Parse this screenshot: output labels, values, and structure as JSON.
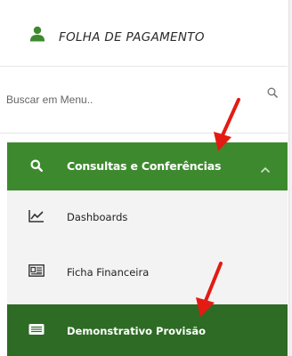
{
  "header": {
    "title": "FOLHA DE PAGAMENTO",
    "icon": "user-icon"
  },
  "search": {
    "placeholder": "Buscar em Menu..",
    "value": "",
    "icon": "search-icon"
  },
  "menu": {
    "group": {
      "label": "Consultas e Conferências",
      "icon": "search-icon",
      "expanded": true
    },
    "items": [
      {
        "label": "Dashboards",
        "icon": "chart-line-icon",
        "active": false
      },
      {
        "label": "Ficha Financeira",
        "icon": "id-card-icon",
        "active": false
      },
      {
        "label": "Demonstrativo Provisão",
        "icon": "list-card-icon",
        "active": true
      }
    ]
  },
  "colors": {
    "accent": "#3d8a2e",
    "active": "#2e6b25",
    "annotation_arrow": "#e31b12"
  }
}
